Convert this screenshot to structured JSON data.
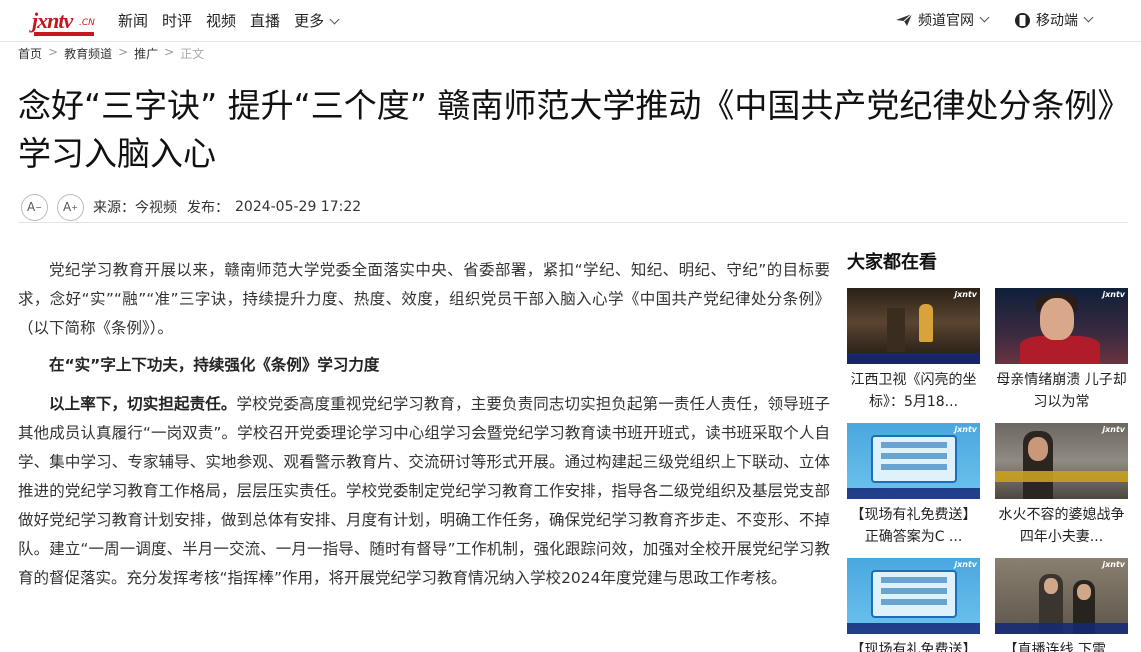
{
  "header": {
    "logo_text": "jxntv",
    "logo_suffix": ".CN",
    "nav": [
      "新闻",
      "时评",
      "视频",
      "直播",
      "更多"
    ],
    "channel_site": "频道官网",
    "mobile": "移动端"
  },
  "breadcrumb": [
    "首页",
    "教育频道",
    "推广",
    "正文"
  ],
  "article": {
    "title": "念好“三字诀” 提升“三个度” 赣南师范大学推动《中国共产党纪律处分条例》学习入脑入心",
    "font_decrease": "A",
    "font_increase": "A",
    "source_label": "来源：",
    "source": "今视频",
    "publish_label": "发布：",
    "publish_time": "2024-05-29 17:22",
    "p1": "党纪学习教育开展以来，赣南师范大学党委全面落实中央、省委部署，紧扣“学纪、知纪、明纪、守纪”的目标要求，念好“实”“融”“准”三字诀，持续提升力度、热度、效度，组织党员干部入脑入心学《中国共产党纪律处分条例》（以下简称《条例》）。",
    "h1": "在“实”字上下功夫，持续强化《条例》学习力度",
    "p2_bold": "以上率下，切实担起责任。",
    "p2": "学校党委高度重视党纪学习教育，主要负责同志切实担负起第一责任人责任，领导班子其他成员认真履行“一岗双责”。学校召开党委理论学习中心组学习会暨党纪学习教育读书班开班式，读书班采取个人自学、集中学习、专家辅导、实地参观、观看警示教育片、交流研讨等形式开展。通过构建起三级党组织上下联动、立体推进的党纪学习教育工作格局，层层压实责任。学校党委制定党纪学习教育工作安排，指导各二级党组织及基层党支部做好党纪学习教育计划安排，做到总体有安排、月度有计划，明确工作任务，确保党纪学习教育齐步走、不变形、不掉队。建立“一周一调度、半月一交流、一月一指导、随时有督导”工作机制，强化跟踪问效，加强对全校开展党纪学习教育的督促落实。充分发挥考核“指挥棒”作用，将开展党纪学习教育情况纳入学校2024年度党建与思政工作考核。"
  },
  "sidebar": {
    "heading": "大家都在看",
    "items": [
      {
        "title": "江西卫视《闪亮的坐标》：5月18..."
      },
      {
        "title": "母亲情绪崩溃 儿子却习以为常"
      },
      {
        "title": "【现场有礼免费送】正确答案为C ..."
      },
      {
        "title": "水火不容的婆媳战争 四年小夫妻..."
      },
      {
        "title": "【现场有礼免费送】正确答案为C ..."
      },
      {
        "title": "【直播连线 下雷..."
      }
    ]
  }
}
